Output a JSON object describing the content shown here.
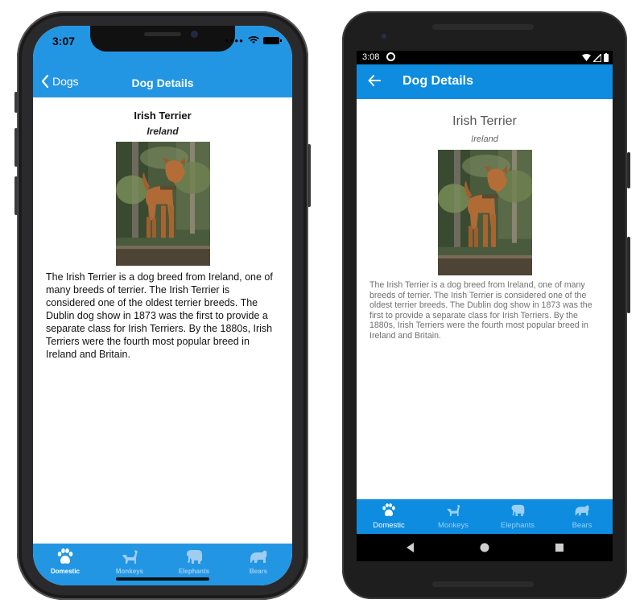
{
  "ios": {
    "status_time": "3:07",
    "back_label": "Dogs",
    "nav_title": "Dog Details",
    "dog_name": "Irish Terrier",
    "dog_origin": "Ireland",
    "description": "The Irish Terrier is a dog breed from Ireland, one of many breeds of terrier. The Irish Terrier is considered one of the oldest terrier breeds. The Dublin dog show in 1873 was the first to provide a separate class for Irish Terriers. By the 1880s, Irish Terriers were the fourth most popular breed in Ireland and Britain.",
    "tabs": [
      {
        "label": "Domestic",
        "icon": "paw-icon",
        "active": true
      },
      {
        "label": "Monkeys",
        "icon": "dog-icon",
        "active": false
      },
      {
        "label": "Elephants",
        "icon": "elephant-icon",
        "active": false
      },
      {
        "label": "Bears",
        "icon": "bear-icon",
        "active": false
      }
    ]
  },
  "android": {
    "status_time": "3:08",
    "nav_title": "Dog Details",
    "dog_name": "Irish Terrier",
    "dog_origin": "Ireland",
    "description": "The Irish Terrier is a dog breed from Ireland, one of many breeds of terrier. The Irish Terrier is considered one of the oldest terrier breeds. The Dublin dog show in 1873 was the first to provide a separate class for Irish Terriers. By the 1880s, Irish Terriers were the fourth most popular breed in Ireland and Britain.",
    "tabs": [
      {
        "label": "Domestic",
        "icon": "paw-icon",
        "active": true
      },
      {
        "label": "Monkeys",
        "icon": "dog-icon",
        "active": false
      },
      {
        "label": "Elephants",
        "icon": "elephant-icon",
        "active": false
      },
      {
        "label": "Bears",
        "icon": "bear-icon",
        "active": false
      }
    ]
  },
  "colors": {
    "ios_accent": "#2396e3",
    "android_accent": "#0d8ce0",
    "inactive_tab_label": "#9fcdf2"
  }
}
